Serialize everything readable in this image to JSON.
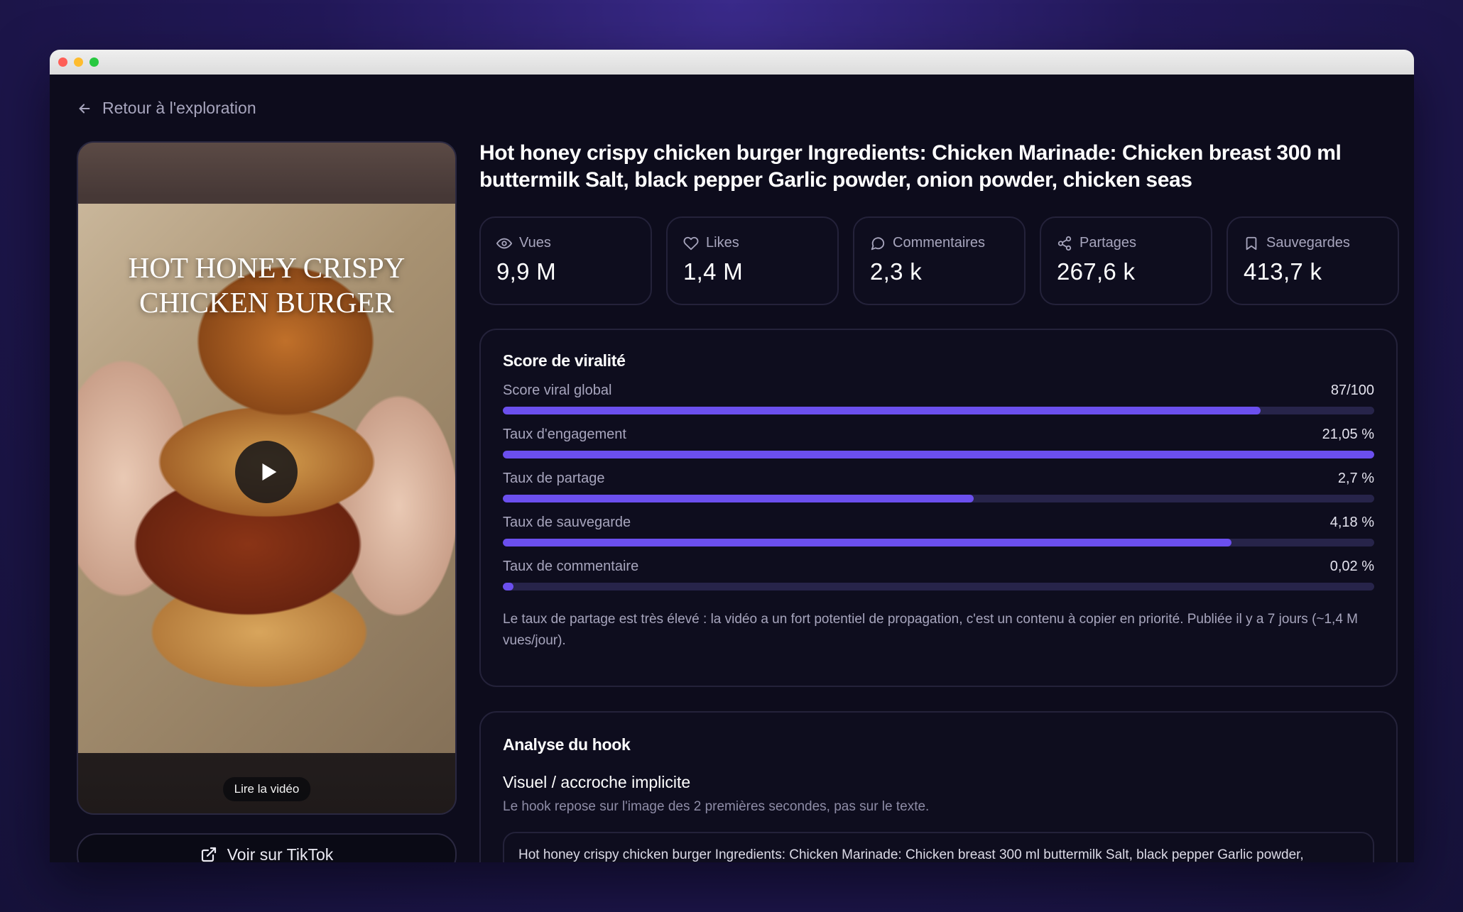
{
  "nav": {
    "back_label": "Retour à l'exploration"
  },
  "video": {
    "overlay_title": "HOT HONEY CRISPY CHICKEN BURGER",
    "play_chip": "Lire la vidéo",
    "tiktok_button": "Voir sur TikTok"
  },
  "headline": "Hot honey crispy chicken burger Ingredients: Chicken Marinade: Chicken breast 300 ml buttermilk Salt, black pepper Garlic powder, onion powder, chicken seas",
  "stats": [
    {
      "icon": "eye-icon",
      "label": "Vues",
      "value": "9,9 M"
    },
    {
      "icon": "heart-icon",
      "label": "Likes",
      "value": "1,4 M"
    },
    {
      "icon": "comment-icon",
      "label": "Commentaires",
      "value": "2,3 k"
    },
    {
      "icon": "share-icon",
      "label": "Partages",
      "value": "267,6 k"
    },
    {
      "icon": "bookmark-icon",
      "label": "Sauvegardes",
      "value": "413,7 k"
    }
  ],
  "virality": {
    "title": "Score de viralité",
    "metrics": [
      {
        "label": "Score viral global",
        "value": "87/100",
        "fill": 0.87
      },
      {
        "label": "Taux d'engagement",
        "value": "21,05 %",
        "fill": 1.0
      },
      {
        "label": "Taux de partage",
        "value": "2,7 %",
        "fill": 0.54
      },
      {
        "label": "Taux de sauvegarde",
        "value": "4,18 %",
        "fill": 0.836
      },
      {
        "label": "Taux de commentaire",
        "value": "0,02 %",
        "fill": 0.012
      }
    ],
    "note": "Le taux de partage est très élevé : la vidéo a un fort potentiel de propagation, c'est un contenu à copier en priorité. Publiée il y a 7 jours (~1,4 M vues/jour)."
  },
  "hook": {
    "title": "Analyse du hook",
    "type": "Visuel / accroche implicite",
    "description": "Le hook repose sur l'image des 2 premières secondes, pas sur le texte.",
    "quote": "Hot honey crispy chicken burger Ingredients: Chicken Marinade: Chicken breast 300 ml buttermilk Salt, black pepper Garlic powder,"
  },
  "colors": {
    "accent": "#6b4fee",
    "track": "#27244a",
    "background": "#0d0c1c"
  }
}
